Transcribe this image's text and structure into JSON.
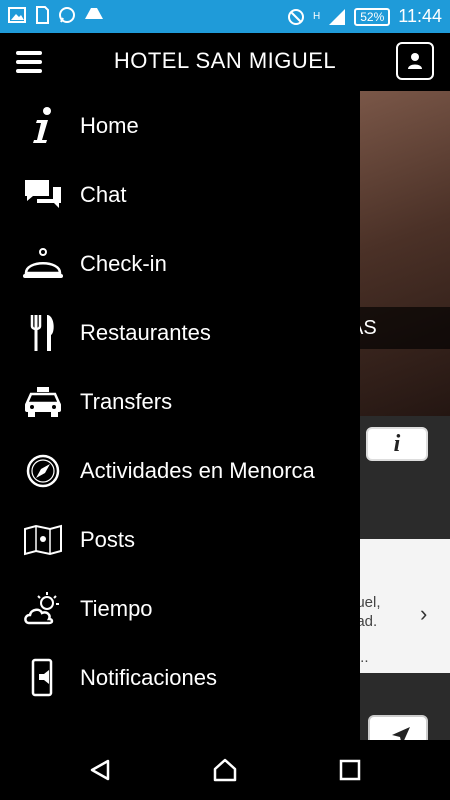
{
  "status_bar": {
    "time": "11:44",
    "battery": "52%",
    "network": "H",
    "left_icons": [
      "image-icon",
      "sim-icon",
      "whatsapp-icon",
      "drive-icon"
    ],
    "right_icons": [
      "blocked-icon",
      "signal-icon",
      "battery-icon"
    ]
  },
  "app_bar": {
    "title": "HOTEL SAN MIGUEL"
  },
  "drawer": {
    "items": [
      {
        "label": "Home",
        "icon": "info-icon"
      },
      {
        "label": "Chat",
        "icon": "chat-icon"
      },
      {
        "label": "Check-in",
        "icon": "reception-bell-icon"
      },
      {
        "label": "Restaurantes",
        "icon": "fork-knife-icon"
      },
      {
        "label": "Transfers",
        "icon": "taxi-icon"
      },
      {
        "label": "Actividades en Menorca",
        "icon": "compass-icon"
      },
      {
        "label": "Posts",
        "icon": "map-icon"
      },
      {
        "label": "Tiempo",
        "icon": "weather-icon"
      },
      {
        "label": "Notificaciones",
        "icon": "phone-notification-icon"
      }
    ]
  },
  "background": {
    "photo_label": "AS",
    "card_line1": "guel,",
    "card_line2": "dad.",
    "card_ellipsis": "..."
  },
  "colors": {
    "status_bar": "#1f9bd9",
    "drawer": "#000000"
  }
}
